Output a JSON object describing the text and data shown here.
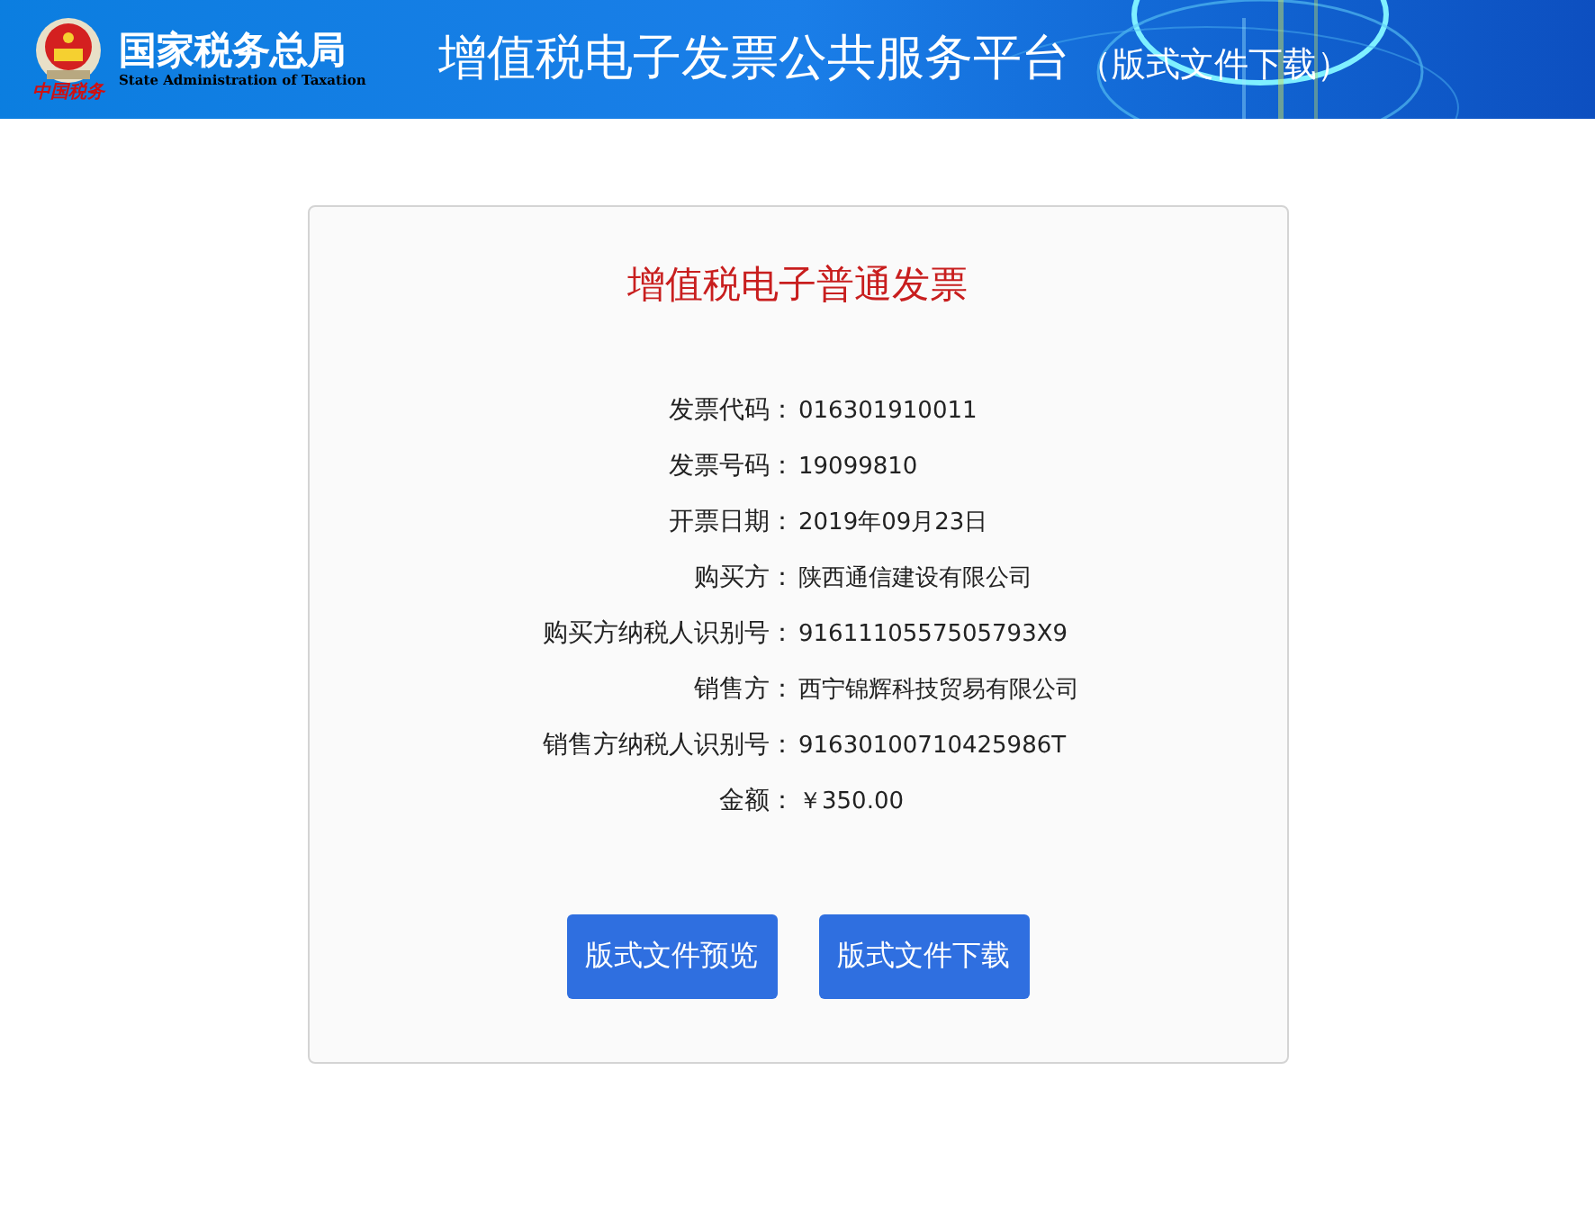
{
  "header": {
    "agency_name": "国家税务总局",
    "agency_name_en": "State Administration of Taxation",
    "emblem_caption": "中国税务",
    "platform_title": "增值税电子发票公共服务平台",
    "platform_subtitle": "（版式文件下载）"
  },
  "invoice": {
    "title": "增值税电子普通发票",
    "fields": [
      {
        "label": "发票代码：",
        "value": "016301910011"
      },
      {
        "label": "发票号码：",
        "value": "19099810"
      },
      {
        "label": "开票日期：",
        "value": "2019年09月23日"
      },
      {
        "label": "购买方：",
        "value": "陕西通信建设有限公司"
      },
      {
        "label": "购买方纳税人识别号：",
        "value": "9161110557505793X9"
      },
      {
        "label": "销售方：",
        "value": "西宁锦辉科技贸易有限公司"
      },
      {
        "label": "销售方纳税人识别号：",
        "value": "91630100710425986T"
      },
      {
        "label": "金额：",
        "value": "￥350.00"
      }
    ],
    "buttons": [
      "版式文件预览",
      "版式文件下载"
    ]
  }
}
